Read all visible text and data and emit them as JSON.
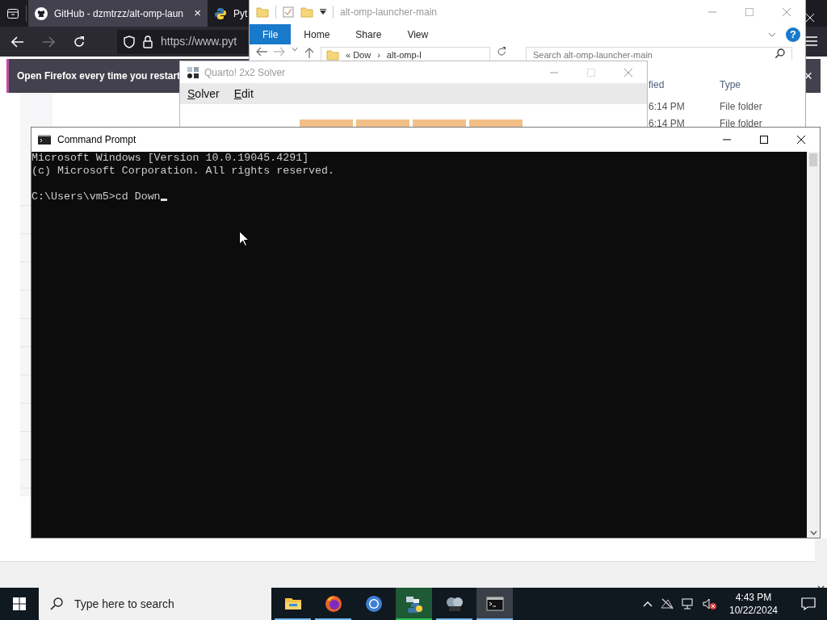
{
  "browser": {
    "tabs": [
      {
        "label": "GitHub - dzmtrzz/alt-omp-laun",
        "kind": "github",
        "selected": true,
        "close": "×"
      },
      {
        "label": "Pyt",
        "kind": "python",
        "selected": false
      }
    ],
    "url": "https://www.pyt",
    "notification": {
      "text": "Open Firefox every time you restart",
      "close": "×"
    }
  },
  "explorer": {
    "title": "alt-omp-launcher-main",
    "ribbon_tabs": [
      {
        "label": "File",
        "selected": true
      },
      {
        "label": "Home",
        "selected": false
      },
      {
        "label": "Share",
        "selected": false
      },
      {
        "label": "View",
        "selected": false
      }
    ],
    "address": [
      "« Dow",
      "›",
      "alt-omp-l"
    ],
    "search": {
      "placeholder": "Search alt-omp-launcher-main"
    },
    "help": "?",
    "columns": [
      "fied",
      "Type"
    ],
    "rows": [
      {
        "column_1": "6:14 PM",
        "type": "File folder"
      },
      {
        "column_1": "6:14 PM",
        "type": "File folder"
      }
    ]
  },
  "quarto": {
    "title": "Quarto! 2x2 Solver",
    "menus": [
      "Solver",
      "Edit"
    ]
  },
  "cmd": {
    "title": "Command Prompt",
    "output": [
      "Microsoft Windows [Version 10.0.19045.4291]",
      "(c) Microsoft Corporation. All rights reserved."
    ],
    "prompt": "C:\\Users\\vm5>cd Down"
  },
  "taskbar": {
    "search": {
      "placeholder": "Type here to search"
    },
    "apps": [
      {
        "kind": "explorer",
        "running": true,
        "selected": false,
        "attention": false
      },
      {
        "kind": "firefox",
        "running": true,
        "selected": false,
        "attention": false
      },
      {
        "kind": "chrome",
        "running": false,
        "selected": false,
        "attention": false
      },
      {
        "kind": "python",
        "running": true,
        "selected": false,
        "attention": true
      },
      {
        "kind": "quarto",
        "running": true,
        "selected": false,
        "attention": false
      },
      {
        "kind": "cmd",
        "running": true,
        "selected": true,
        "attention": false
      }
    ],
    "time": "4:43 PM",
    "date": "10/22/2024"
  }
}
